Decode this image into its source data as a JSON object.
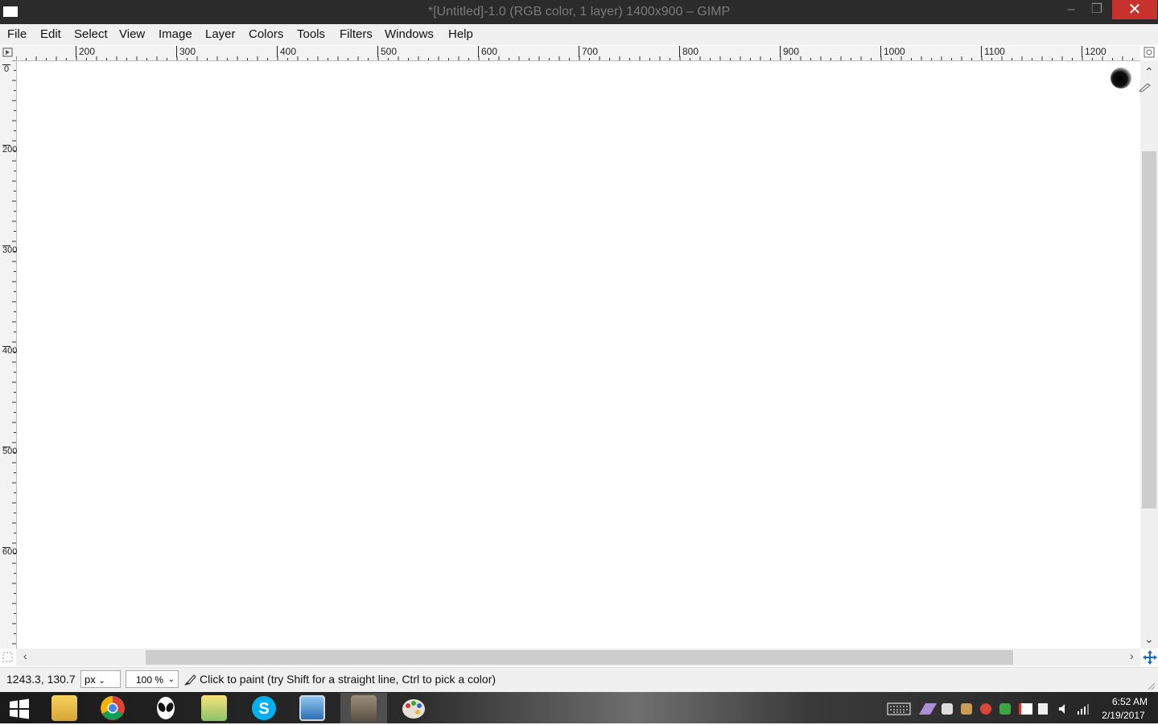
{
  "window": {
    "title": "*[Untitled]-1.0 (RGB color, 1 layer) 1400x900 – GIMP",
    "minimize": "–",
    "maximize": "❐",
    "close": "✕"
  },
  "menu": [
    "File",
    "Edit",
    "Select",
    "View",
    "Image",
    "Layer",
    "Colors",
    "Tools",
    "Filters",
    "Windows",
    "Help"
  ],
  "ruler": {
    "h_labels": [
      "200",
      "300",
      "400",
      "500",
      "600",
      "700",
      "800",
      "900",
      "1000",
      "1100",
      "1200"
    ],
    "v_labels": [
      "0",
      "200",
      "300",
      "400",
      "500",
      "600"
    ]
  },
  "status": {
    "coords": "1243.3, 130.7",
    "unit": "px",
    "zoom": "100 %",
    "message": "Click to paint (try Shift for a straight line, Ctrl to pick a color)"
  },
  "taskbar": {
    "time": "6:52 AM",
    "date": "2/19/2017",
    "apps": [
      "start",
      "file-explorer",
      "chrome",
      "alien-app",
      "folder",
      "skype",
      "photo-viewer",
      "gimp",
      "paint"
    ]
  },
  "colors": {
    "titlebar": "#2b2b2b",
    "close": "#c7322d",
    "menubar": "#f0f0f0"
  }
}
